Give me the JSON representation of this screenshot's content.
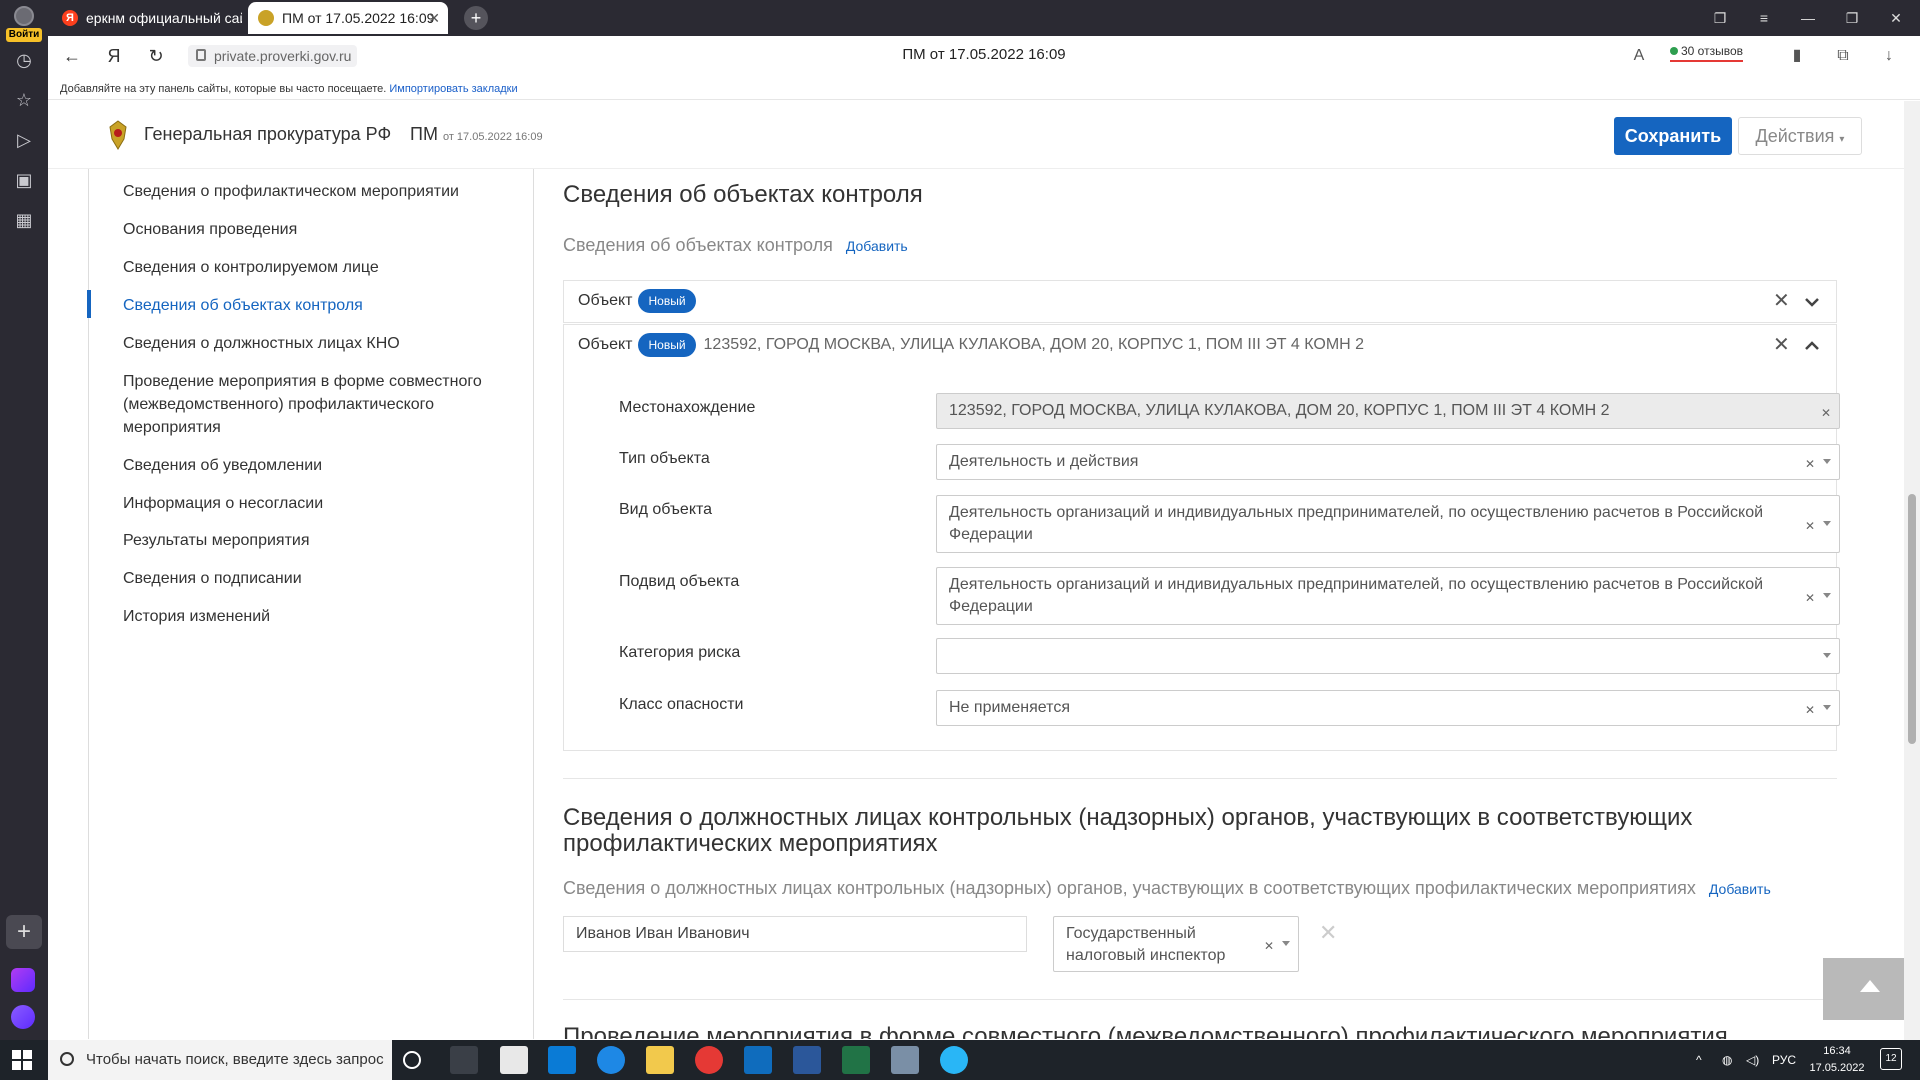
{
  "browser": {
    "login_label": "Войти",
    "tabs": [
      {
        "title": "еркнм официальный сайт",
        "favicon": "Я"
      },
      {
        "title": "ПМ от 17.05.2022 16:09"
      }
    ],
    "url": "private.proverki.gov.ru",
    "page_title": "ПМ от 17.05.2022 16:09",
    "reviews": "30 отзывов",
    "bookmarks_text": "Добавляйте на эту панель сайты, которые вы часто посещаете.",
    "bookmarks_link": "Импортировать закладки"
  },
  "header": {
    "brand": "Генеральная прокуратура РФ",
    "doc_short": "ПМ",
    "doc_date": "от 17.05.2022 16:09",
    "save_label": "Сохранить",
    "actions_label": "Действия"
  },
  "sidebar": {
    "items": [
      {
        "label": "Сведения о профилактическом мероприятии"
      },
      {
        "label": "Основания проведения"
      },
      {
        "label": "Сведения о контролируемом лице"
      },
      {
        "label": "Сведения об объектах контроля",
        "active": true
      },
      {
        "label": "Сведения о должностных лицах КНО"
      },
      {
        "label": "Проведение мероприятия в форме совместного (межведомственного) профилактического мероприятия"
      },
      {
        "label": "Сведения об уведомлении"
      },
      {
        "label": "Информация о несогласии"
      },
      {
        "label": "Результаты мероприятия"
      },
      {
        "label": "Сведения о подписании"
      },
      {
        "label": "История изменений"
      }
    ]
  },
  "objects_section": {
    "title": "Сведения об объектах контроля",
    "subtitle": "Сведения об объектах контроля",
    "add_label": "Добавить",
    "objects": [
      {
        "label": "Объект",
        "badge": "Новый",
        "address": ""
      },
      {
        "label": "Объект",
        "badge": "Новый",
        "address": "123592, ГОРОД МОСКВА, УЛИЦА КУЛАКОВА, ДОМ 20, КОРПУС 1, ПОМ III ЭТ 4 КОМН 2"
      }
    ],
    "fields": {
      "location": {
        "label": "Местонахождение",
        "value": "123592, ГОРОД МОСКВА, УЛИЦА КУЛАКОВА, ДОМ 20, КОРПУС 1, ПОМ III ЭТ 4 КОМН 2"
      },
      "type": {
        "label": "Тип объекта",
        "value": "Деятельность и действия"
      },
      "kind": {
        "label": "Вид объекта",
        "value": "Деятельность организаций и индивидуальных предпринимателей, по осуществлению расчетов в Российской Федерации"
      },
      "subkind": {
        "label": "Подвид объекта",
        "value": "Деятельность организаций и индивидуальных предпринимателей, по осуществлению расчетов в Российской Федерации"
      },
      "risk": {
        "label": "Категория риска",
        "value": ""
      },
      "hazard": {
        "label": "Класс опасности",
        "value": "Не применяется"
      }
    }
  },
  "officials_section": {
    "title": "Сведения о должностных лицах контрольных (надзорных) органов, участвующих в соответствующих профилактических мероприятиях",
    "subtitle": "Сведения о должностных лицах контрольных (надзорных) органов, участвующих в соответствующих профилактических мероприятиях",
    "add_label": "Добавить",
    "person_name": "Иванов Иван Иванович",
    "position": "Государственный налоговый инспектор"
  },
  "joint_section": {
    "title": "Проведение мероприятия в форме совместного (межведомственного) профилактического мероприятия"
  },
  "taskbar": {
    "search_placeholder": "Чтобы начать поиск, введите здесь запрос",
    "lang": "РУС",
    "time": "16:34",
    "date": "17.05.2022",
    "notifications": "12"
  },
  "colors": {
    "accent": "#1565c0",
    "rail": "#2b2a33",
    "taskbar": "#1e2329"
  }
}
